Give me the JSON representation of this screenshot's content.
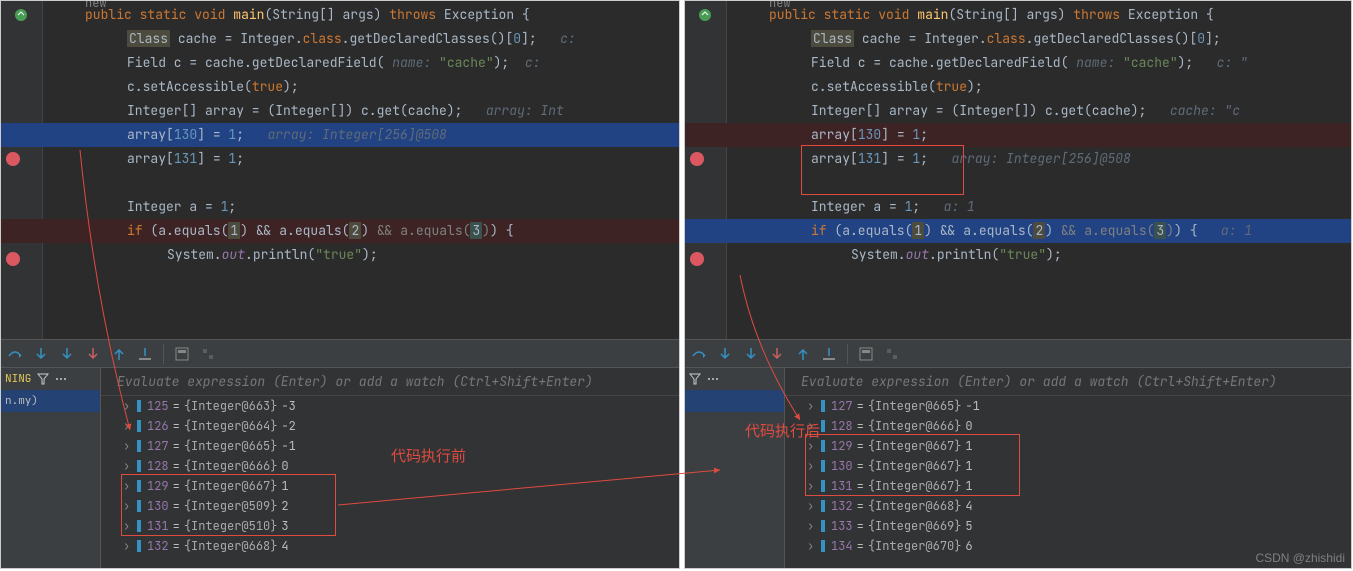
{
  "left": {
    "new_label": "new",
    "lines": {
      "sig_public": "public",
      "sig_static": "static",
      "sig_void": "void",
      "sig_main": "main",
      "sig_rest": "(String[] args)",
      "sig_throws": "throws",
      "sig_exc": "Exception {",
      "l2a": "Class",
      "l2b": " cache = Integer.",
      "l2c": "class",
      "l2d": ".getDeclaredClasses()[",
      "l2n": "0",
      "l2e": "];",
      "l2hint": "c:",
      "l3a": "Field c = cache.getDeclaredField(",
      "l3p": " name: ",
      "l3s": "\"cache\"",
      "l3b": ");",
      "l3hint": "c: ",
      "l4a": "c.setAccessible(",
      "l4b": "true",
      "l4c": ");",
      "l5a": "Integer[] array = (Integer[]) c.get(cache);",
      "l5hint": "array: Int",
      "l6a": "array[",
      "l6n": "130",
      "l6b": "] = ",
      "l6v": "1",
      "l6c": ";",
      "l6hint": "array: Integer[256]@508",
      "l7a": "array[",
      "l7n": "131",
      "l7b": "] = ",
      "l7v": "1",
      "l7c": ";",
      "l9a": "Integer a = ",
      "l9v": "1",
      "l9c": ";",
      "l10a": "if",
      "l10b": " (a.equals(",
      "l10n1": "1",
      "l10c": ") && a.equals(",
      "l10n2": "2",
      "l10d": ") ",
      "l10g": "&& a.equals(",
      "l10n3": "3",
      "l10h": ")",
      "l10e": ") {",
      "l11a": "System.",
      "l11o": "out",
      "l11b": ".println(",
      "l11s": "\"true\"",
      "l11c": ");"
    },
    "input_placeholder": "Evaluate expression (Enter) or add a watch (Ctrl+Shift+Enter)",
    "filter_label": "NING",
    "frame_label": "n.my)",
    "vars": [
      {
        "idx": "125",
        "obj": "{Integer@663}",
        "val": "-3"
      },
      {
        "idx": "126",
        "obj": "{Integer@664}",
        "val": "-2"
      },
      {
        "idx": "127",
        "obj": "{Integer@665}",
        "val": "-1"
      },
      {
        "idx": "128",
        "obj": "{Integer@666}",
        "val": "0"
      },
      {
        "idx": "129",
        "obj": "{Integer@667}",
        "val": "1"
      },
      {
        "idx": "130",
        "obj": "{Integer@509}",
        "val": "2"
      },
      {
        "idx": "131",
        "obj": "{Integer@510}",
        "val": "3"
      },
      {
        "idx": "132",
        "obj": "{Integer@668}",
        "val": "4"
      }
    ],
    "annotation": "代码执行前"
  },
  "right": {
    "new_label": "new",
    "lines": {
      "l2hint": "",
      "l3hint": "c: \"",
      "l5hint": "cache: \"c",
      "l6a": "array[",
      "l6n": "130",
      "l6b": "] = ",
      "l6v": "1",
      "l6c": ";",
      "l7a": "array[",
      "l7n": "131",
      "l7b": "] = ",
      "l7v": "1",
      "l7c": ";",
      "l7hint": "array: Integer[256]@508",
      "l9hint": "a: 1",
      "l10hint": "a: 1"
    },
    "input_placeholder": "Evaluate expression (Enter) or add a watch (Ctrl+Shift+Enter)",
    "vars": [
      {
        "idx": "127",
        "obj": "{Integer@665}",
        "val": "-1"
      },
      {
        "idx": "128",
        "obj": "{Integer@666}",
        "val": "0"
      },
      {
        "idx": "129",
        "obj": "{Integer@667}",
        "val": "1"
      },
      {
        "idx": "130",
        "obj": "{Integer@667}",
        "val": "1"
      },
      {
        "idx": "131",
        "obj": "{Integer@667}",
        "val": "1"
      },
      {
        "idx": "132",
        "obj": "{Integer@668}",
        "val": "4"
      },
      {
        "idx": "133",
        "obj": "{Integer@669}",
        "val": "5"
      },
      {
        "idx": "134",
        "obj": "{Integer@670}",
        "val": "6"
      }
    ],
    "annotation": "代码执行后"
  },
  "watermark": "CSDN @zhishidi"
}
